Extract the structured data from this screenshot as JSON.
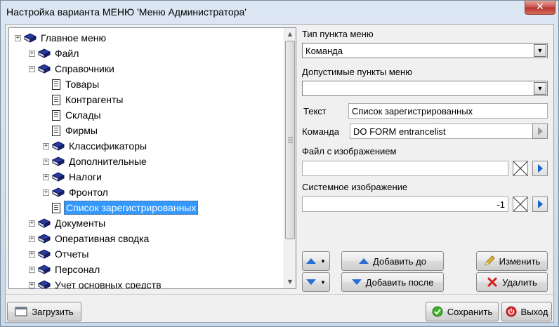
{
  "window": {
    "title": "Настройка варианта МЕНЮ 'Меню Администратора'",
    "close_glyph": "✕"
  },
  "tree": {
    "items": [
      {
        "label": "Главное меню",
        "icon": "book-icon",
        "expander": "+",
        "selected": false
      },
      {
        "label": "Файл",
        "icon": "book-icon",
        "expander": "+",
        "selected": false
      },
      {
        "label": "Справочники",
        "icon": "book-icon",
        "expander": "−",
        "selected": false
      },
      {
        "label": "Товары",
        "icon": "document-icon",
        "expander": "",
        "selected": false
      },
      {
        "label": "Контрагенты",
        "icon": "document-icon",
        "expander": "",
        "selected": false
      },
      {
        "label": "Склады",
        "icon": "document-icon",
        "expander": "",
        "selected": false
      },
      {
        "label": "Фирмы",
        "icon": "document-icon",
        "expander": "",
        "selected": false
      },
      {
        "label": "Классификаторы",
        "icon": "book-icon",
        "expander": "+",
        "selected": false
      },
      {
        "label": "Дополнительные",
        "icon": "book-icon",
        "expander": "+",
        "selected": false
      },
      {
        "label": "Налоги",
        "icon": "book-icon",
        "expander": "+",
        "selected": false
      },
      {
        "label": "Фронтол",
        "icon": "book-icon",
        "expander": "+",
        "selected": false
      },
      {
        "label": "Список зарегистрированных",
        "icon": "document-icon",
        "expander": "",
        "selected": true
      },
      {
        "label": "Документы",
        "icon": "book-icon",
        "expander": "+",
        "selected": false
      },
      {
        "label": "Оперативная сводка",
        "icon": "book-icon",
        "expander": "+",
        "selected": false
      },
      {
        "label": "Отчеты",
        "icon": "book-icon",
        "expander": "+",
        "selected": false
      },
      {
        "label": "Персонал",
        "icon": "book-icon",
        "expander": "+",
        "selected": false
      },
      {
        "label": "Учет основных средств",
        "icon": "book-icon",
        "expander": "+",
        "selected": false
      }
    ]
  },
  "form": {
    "item_type_label": "Тип пункта меню",
    "item_type_value": "Команда",
    "allowed_items_label": "Допустимые пункты меню",
    "allowed_items_value": "",
    "text_label": "Текст",
    "text_value": "Список зарегистрированных",
    "command_label": "Команда",
    "command_value": "DO FORM entrancelist",
    "image_file_label": "Файл с изображением",
    "image_file_value": "",
    "system_image_label": "Системное изображение",
    "system_image_value": "-1"
  },
  "buttons": {
    "add_before": "Добавить до",
    "add_after": "Добавить после",
    "edit": "Изменить",
    "delete": "Удалить",
    "load": "Загрузить",
    "save": "Сохранить",
    "exit": "Выход"
  },
  "colors": {
    "selection": "#3399ff",
    "accent_blue": "#2a6fd6",
    "book_blue": "#1f2f8f"
  }
}
